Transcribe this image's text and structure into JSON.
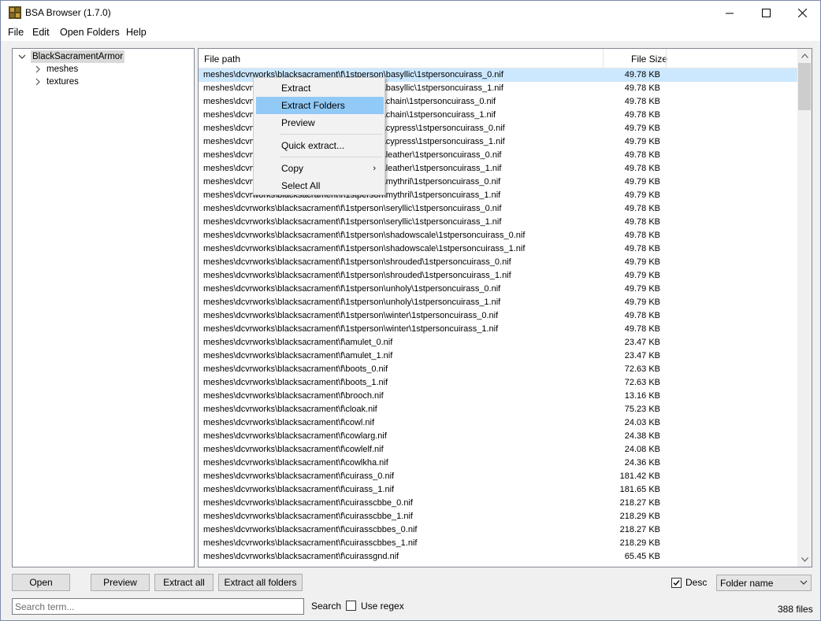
{
  "window": {
    "title": "BSA Browser (1.7.0)"
  },
  "menu": [
    "File",
    "Edit",
    "Open Folders",
    "Help"
  ],
  "tree": {
    "root": "BlackSacramentArmor",
    "children": [
      "meshes",
      "textures"
    ]
  },
  "list": {
    "headers": {
      "path": "File path",
      "size": "File Size"
    },
    "rows": [
      {
        "path": "meshes\\dcvrworks\\blacksacrament\\f\\1stperson\\basyllic\\1stpersoncuirass_0.nif",
        "size": "49.78 KB"
      },
      {
        "path": "meshes\\dcvrworks\\blacksacrament\\f\\1stperson\\basyllic\\1stpersoncuirass_1.nif",
        "size": "49.78 KB"
      },
      {
        "path": "meshes\\dcvrworks\\blacksacrament\\f\\1stperson\\chain\\1stpersoncuirass_0.nif",
        "size": "49.78 KB"
      },
      {
        "path": "meshes\\dcvrworks\\blacksacrament\\f\\1stperson\\chain\\1stpersoncuirass_1.nif",
        "size": "49.78 KB"
      },
      {
        "path": "meshes\\dcvrworks\\blacksacrament\\f\\1stperson\\cypress\\1stpersoncuirass_0.nif",
        "size": "49.79 KB"
      },
      {
        "path": "meshes\\dcvrworks\\blacksacrament\\f\\1stperson\\cypress\\1stpersoncuirass_1.nif",
        "size": "49.79 KB"
      },
      {
        "path": "meshes\\dcvrworks\\blacksacrament\\f\\1stperson\\leather\\1stpersoncuirass_0.nif",
        "size": "49.78 KB"
      },
      {
        "path": "meshes\\dcvrworks\\blacksacrament\\f\\1stperson\\leather\\1stpersoncuirass_1.nif",
        "size": "49.78 KB"
      },
      {
        "path": "meshes\\dcvrworks\\blacksacrament\\f\\1stperson\\mythril\\1stpersoncuirass_0.nif",
        "size": "49.79 KB"
      },
      {
        "path": "meshes\\dcvrworks\\blacksacrament\\f\\1stperson\\mythril\\1stpersoncuirass_1.nif",
        "size": "49.79 KB"
      },
      {
        "path": "meshes\\dcvrworks\\blacksacrament\\f\\1stperson\\seryllic\\1stpersoncuirass_0.nif",
        "size": "49.78 KB"
      },
      {
        "path": "meshes\\dcvrworks\\blacksacrament\\f\\1stperson\\seryllic\\1stpersoncuirass_1.nif",
        "size": "49.78 KB"
      },
      {
        "path": "meshes\\dcvrworks\\blacksacrament\\f\\1stperson\\shadowscale\\1stpersoncuirass_0.nif",
        "size": "49.78 KB"
      },
      {
        "path": "meshes\\dcvrworks\\blacksacrament\\f\\1stperson\\shadowscale\\1stpersoncuirass_1.nif",
        "size": "49.78 KB"
      },
      {
        "path": "meshes\\dcvrworks\\blacksacrament\\f\\1stperson\\shrouded\\1stpersoncuirass_0.nif",
        "size": "49.79 KB"
      },
      {
        "path": "meshes\\dcvrworks\\blacksacrament\\f\\1stperson\\shrouded\\1stpersoncuirass_1.nif",
        "size": "49.79 KB"
      },
      {
        "path": "meshes\\dcvrworks\\blacksacrament\\f\\1stperson\\unholy\\1stpersoncuirass_0.nif",
        "size": "49.79 KB"
      },
      {
        "path": "meshes\\dcvrworks\\blacksacrament\\f\\1stperson\\unholy\\1stpersoncuirass_1.nif",
        "size": "49.79 KB"
      },
      {
        "path": "meshes\\dcvrworks\\blacksacrament\\f\\1stperson\\winter\\1stpersoncuirass_0.nif",
        "size": "49.78 KB"
      },
      {
        "path": "meshes\\dcvrworks\\blacksacrament\\f\\1stperson\\winter\\1stpersoncuirass_1.nif",
        "size": "49.78 KB"
      },
      {
        "path": "meshes\\dcvrworks\\blacksacrament\\f\\amulet_0.nif",
        "size": "23.47 KB"
      },
      {
        "path": "meshes\\dcvrworks\\blacksacrament\\f\\amulet_1.nif",
        "size": "23.47 KB"
      },
      {
        "path": "meshes\\dcvrworks\\blacksacrament\\f\\boots_0.nif",
        "size": "72.63 KB"
      },
      {
        "path": "meshes\\dcvrworks\\blacksacrament\\f\\boots_1.nif",
        "size": "72.63 KB"
      },
      {
        "path": "meshes\\dcvrworks\\blacksacrament\\f\\brooch.nif",
        "size": "13.16 KB"
      },
      {
        "path": "meshes\\dcvrworks\\blacksacrament\\f\\cloak.nif",
        "size": "75.23 KB"
      },
      {
        "path": "meshes\\dcvrworks\\blacksacrament\\f\\cowl.nif",
        "size": "24.03 KB"
      },
      {
        "path": "meshes\\dcvrworks\\blacksacrament\\f\\cowlarg.nif",
        "size": "24.38 KB"
      },
      {
        "path": "meshes\\dcvrworks\\blacksacrament\\f\\cowlelf.nif",
        "size": "24.08 KB"
      },
      {
        "path": "meshes\\dcvrworks\\blacksacrament\\f\\cowlkha.nif",
        "size": "24.36 KB"
      },
      {
        "path": "meshes\\dcvrworks\\blacksacrament\\f\\cuirass_0.nif",
        "size": "181.42 KB"
      },
      {
        "path": "meshes\\dcvrworks\\blacksacrament\\f\\cuirass_1.nif",
        "size": "181.65 KB"
      },
      {
        "path": "meshes\\dcvrworks\\blacksacrament\\f\\cuirasscbbe_0.nif",
        "size": "218.27 KB"
      },
      {
        "path": "meshes\\dcvrworks\\blacksacrament\\f\\cuirasscbbe_1.nif",
        "size": "218.29 KB"
      },
      {
        "path": "meshes\\dcvrworks\\blacksacrament\\f\\cuirasscbbes_0.nif",
        "size": "218.27 KB"
      },
      {
        "path": "meshes\\dcvrworks\\blacksacrament\\f\\cuirasscbbes_1.nif",
        "size": "218.29 KB"
      },
      {
        "path": "meshes\\dcvrworks\\blacksacrament\\f\\cuirassgnd.nif",
        "size": "65.45 KB"
      }
    ]
  },
  "context_menu": {
    "items": [
      "Extract",
      "Extract Folders",
      "Preview",
      "Quick extract...",
      "Copy",
      "Select All"
    ],
    "highlighted": "Extract Folders"
  },
  "buttons": {
    "open": "Open",
    "preview": "Preview",
    "extract_all": "Extract all",
    "extract_all_folders": "Extract all folders"
  },
  "sort": {
    "desc_label": "Desc",
    "desc_checked": true,
    "sort_by": "Folder name"
  },
  "search": {
    "placeholder": "Search term...",
    "label": "Search",
    "regex_label": "Use regex",
    "regex_checked": false
  },
  "status": {
    "file_count": "388 files"
  },
  "colors": {
    "selection": "#cce8ff",
    "menu_highlight": "#91c9f7"
  }
}
